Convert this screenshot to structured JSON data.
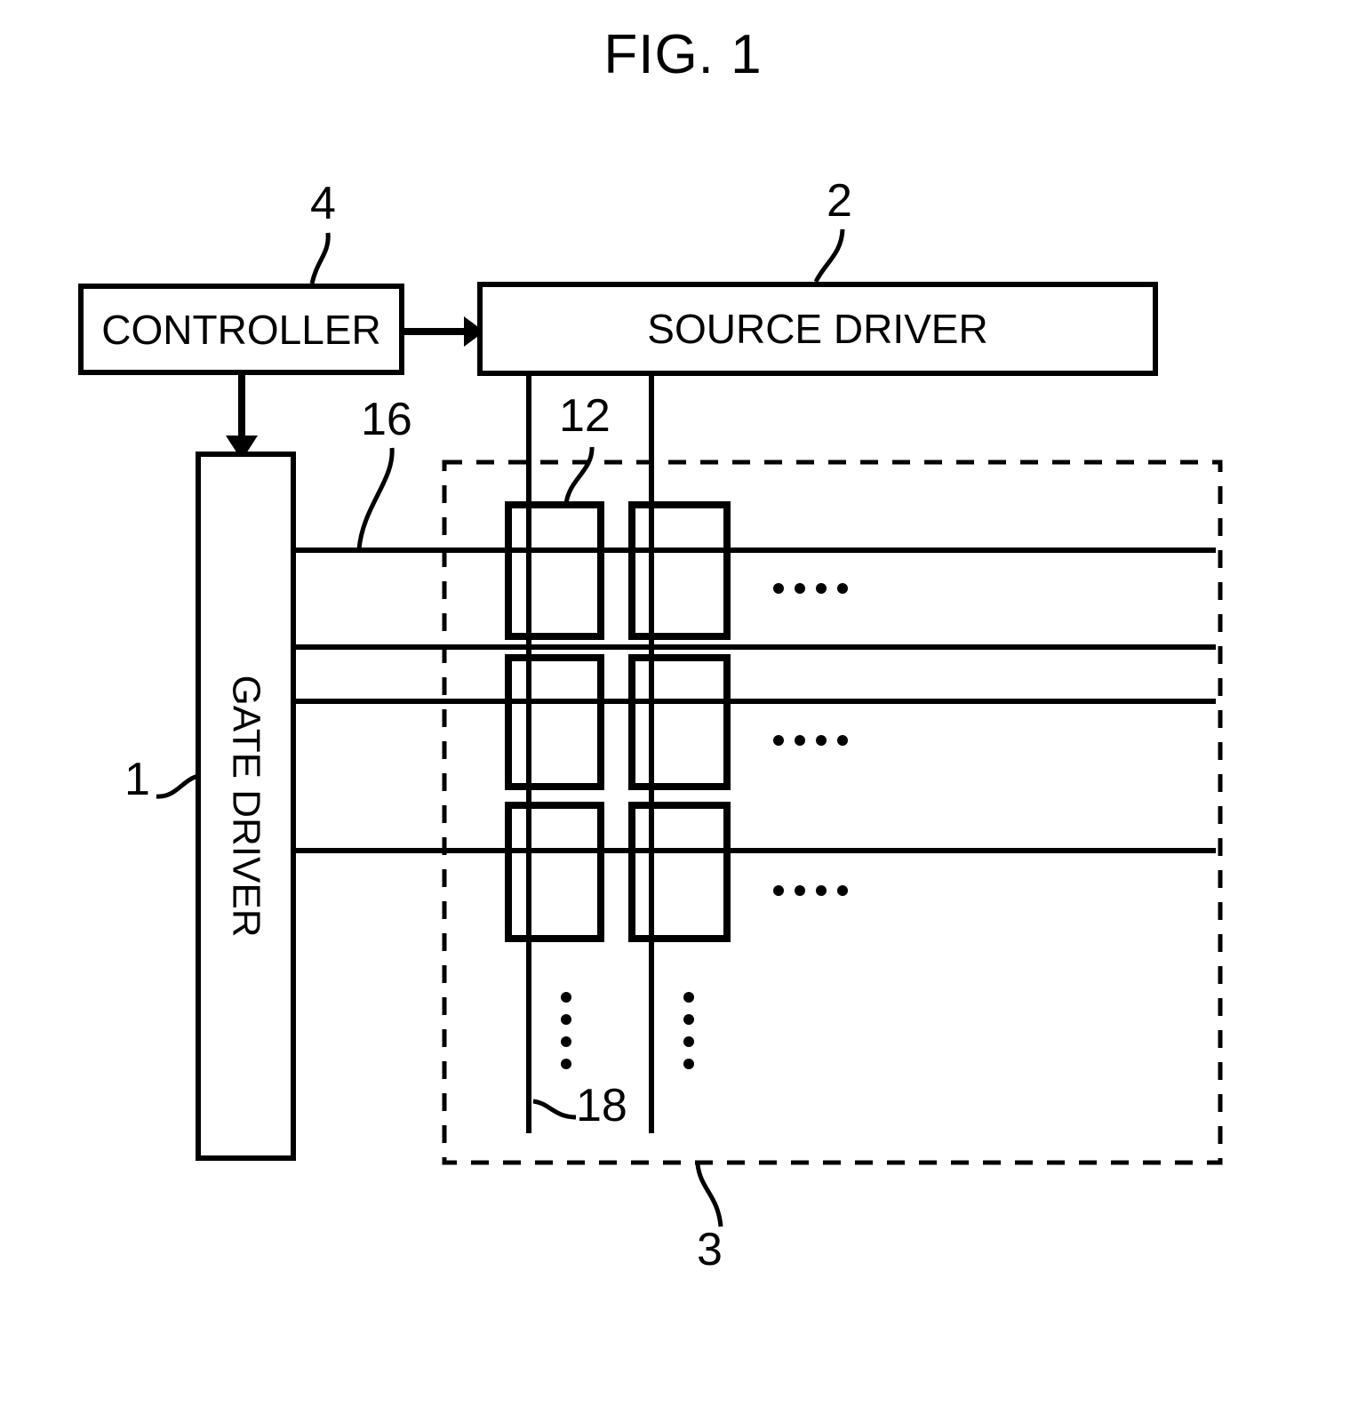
{
  "figure": {
    "title": "FIG. 1",
    "type": "patent-block-diagram",
    "subject": "display device driving architecture"
  },
  "blocks": {
    "controller": {
      "label": "CONTROLLER",
      "numeral": "4"
    },
    "source_driver": {
      "label": "SOURCE DRIVER",
      "numeral": "2"
    },
    "gate_driver": {
      "label": "GATE DRIVER",
      "numeral": "1"
    }
  },
  "numerals": {
    "gate_driver": "1",
    "source_driver": "2",
    "display_panel": "3",
    "controller": "4",
    "pixel": "12",
    "gate_line": "16",
    "source_line": "18"
  },
  "panel": {
    "numeral": "3",
    "style": "dashed",
    "pixel_numeral": "12",
    "gate_line_numeral": "16",
    "source_line_numeral": "18",
    "pixel_rows": 3,
    "pixel_columns": 2,
    "row_continuation_marker": "....",
    "column_continuation_marker": "vertical-dots"
  },
  "colors": {
    "ink": "#000000",
    "paper": "#ffffff"
  }
}
